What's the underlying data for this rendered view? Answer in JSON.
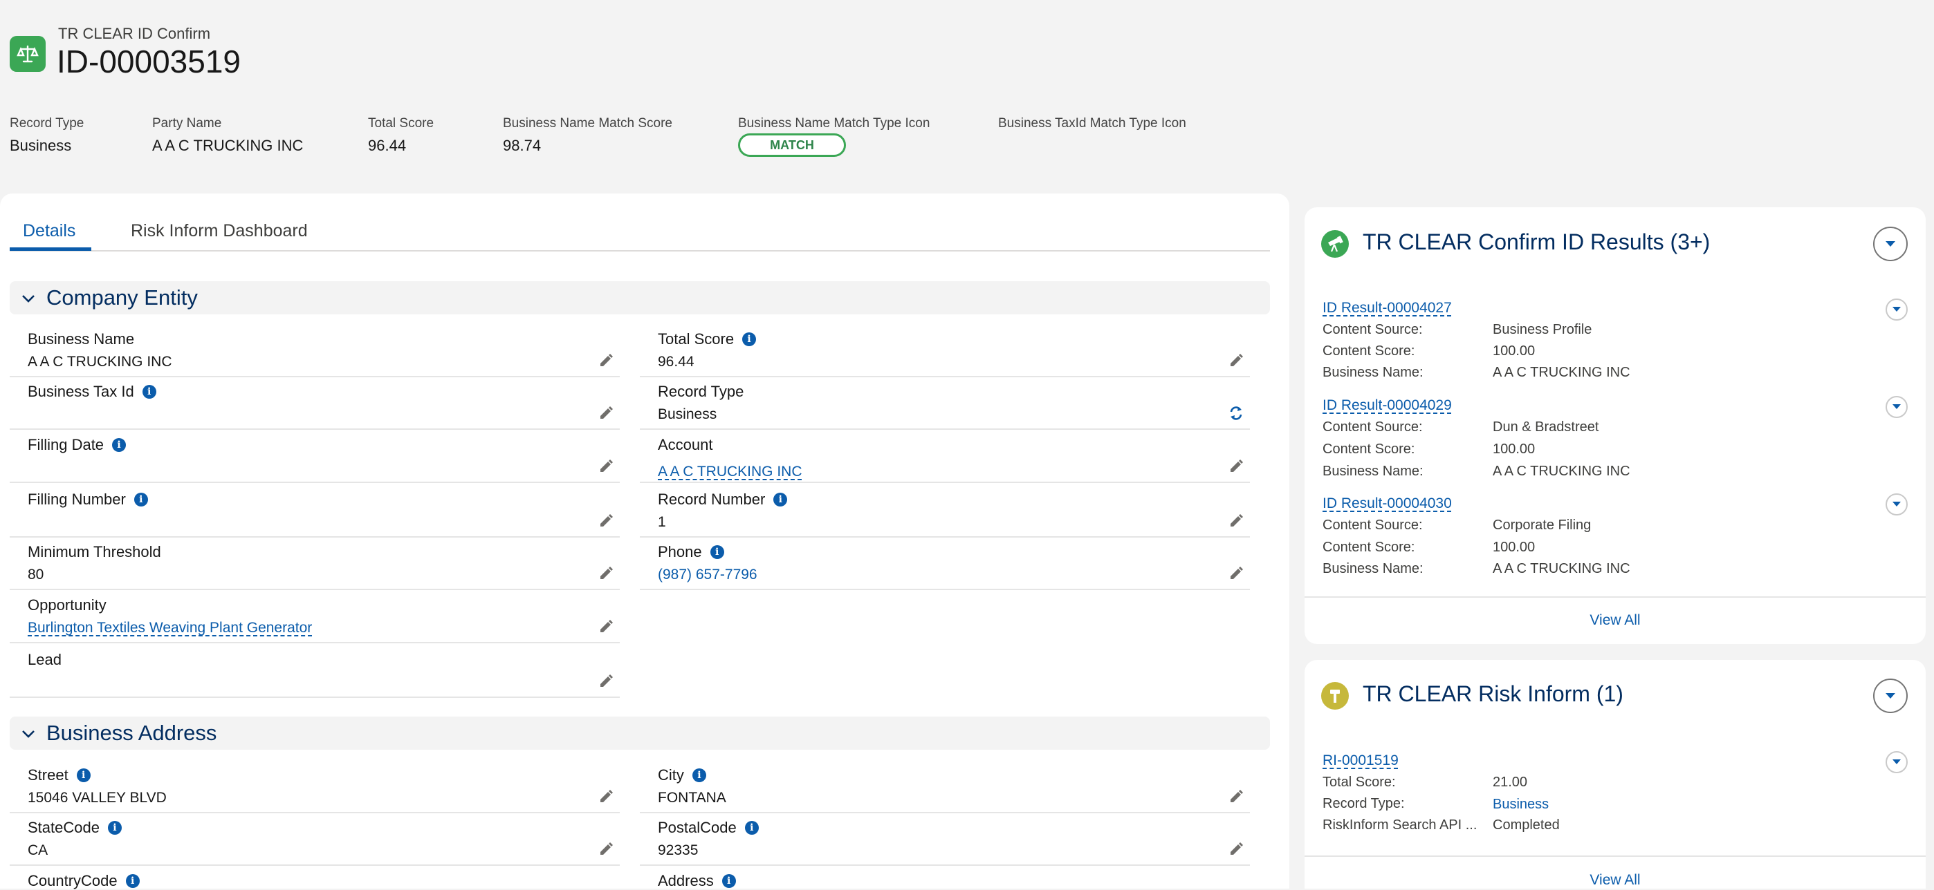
{
  "header": {
    "object_name": "TR CLEAR ID Confirm",
    "record_id": "ID-00003519",
    "highlights": [
      {
        "label": "Record Type",
        "value": "Business"
      },
      {
        "label": "Party Name",
        "value": "A A C TRUCKING INC"
      },
      {
        "label": "Total Score",
        "value": "96.44"
      },
      {
        "label": "Business Name Match Score",
        "value": "98.74"
      },
      {
        "label": "Business Name Match Type Icon",
        "value": "MATCH"
      },
      {
        "label": "Business TaxId Match Type Icon",
        "value": ""
      }
    ]
  },
  "tabs": [
    {
      "label": "Details",
      "active": true
    },
    {
      "label": "Risk Inform Dashboard",
      "active": false
    }
  ],
  "sections": {
    "company": {
      "title": "Company Entity",
      "left": [
        {
          "label": "Business Name",
          "value": "A A C TRUCKING INC",
          "info": false
        },
        {
          "label": "Business Tax Id",
          "value": "",
          "info": true
        },
        {
          "label": "Filling Date",
          "value": "",
          "info": true
        },
        {
          "label": "Filling Number",
          "value": "",
          "info": true
        },
        {
          "label": "Minimum Threshold",
          "value": "80",
          "info": false
        },
        {
          "label": "Opportunity",
          "value": "Burlington Textiles Weaving Plant Generator",
          "info": false
        },
        {
          "label": "Lead",
          "value": "",
          "info": false
        }
      ],
      "right": [
        {
          "label": "Total Score",
          "value": "96.44",
          "info": true
        },
        {
          "label": "Record Type",
          "value": "Business",
          "info": false
        },
        {
          "label": "Account",
          "value": "A A C TRUCKING INC",
          "info": false
        },
        {
          "label": "Record Number",
          "value": "1",
          "info": true
        },
        {
          "label": "Phone",
          "value": "(987) 657-7796",
          "info": true
        }
      ]
    },
    "address": {
      "title": "Business Address",
      "left": [
        {
          "label": "Street",
          "value": "15046 VALLEY BLVD",
          "info": true
        },
        {
          "label": "StateCode",
          "value": "CA",
          "info": true
        },
        {
          "label": "CountryCode",
          "value": "",
          "info": true
        }
      ],
      "right": [
        {
          "label": "City",
          "value": "FONTANA",
          "info": true
        },
        {
          "label": "PostalCode",
          "value": "92335",
          "info": true
        },
        {
          "label": "Address",
          "value": "",
          "info": true
        }
      ]
    }
  },
  "related": {
    "confirm_results": {
      "title": "TR CLEAR Confirm ID Results (3+)",
      "items": [
        {
          "link": "ID Result-00004027",
          "fields": [
            [
              "Content Source:",
              "Business Profile"
            ],
            [
              "Content Score:",
              "100.00"
            ],
            [
              "Business Name:",
              "A A C TRUCKING INC"
            ]
          ]
        },
        {
          "link": "ID Result-00004029",
          "fields": [
            [
              "Content Source:",
              "Dun & Bradstreet"
            ],
            [
              "Content Score:",
              "100.00"
            ],
            [
              "Business Name:",
              "A A C TRUCKING INC"
            ]
          ]
        },
        {
          "link": "ID Result-00004030",
          "fields": [
            [
              "Content Source:",
              "Corporate Filing"
            ],
            [
              "Content Score:",
              "100.00"
            ],
            [
              "Business Name:",
              "A A C TRUCKING INC"
            ]
          ]
        }
      ],
      "view_all": "View All"
    },
    "risk_inform": {
      "title": "TR CLEAR Risk Inform (1)",
      "items": [
        {
          "link": "RI-0001519",
          "fields": [
            [
              "Total Score:",
              "21.00"
            ],
            [
              "Record Type:",
              "Business"
            ],
            [
              "RiskInform Search API ...",
              "Completed"
            ]
          ]
        }
      ],
      "view_all": "View All"
    }
  },
  "colors": {
    "brand_blue": "#0b5cab",
    "header_navy": "#032d60",
    "match_green": "#3ba755",
    "risk_yellow": "#c6b83b"
  }
}
